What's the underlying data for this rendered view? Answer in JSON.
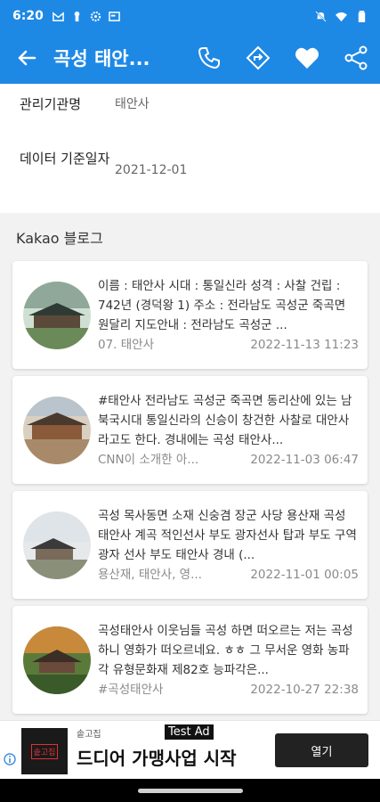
{
  "status_bar": {
    "time": "6:20",
    "left_icons": [
      "gmail-icon",
      "notification-icon",
      "settings-icon",
      "screenshot-icon"
    ],
    "right_icons": [
      "mute-icon",
      "wifi-icon",
      "battery-icon"
    ]
  },
  "app_bar": {
    "title": "곡성 태안...",
    "actions": [
      "phone-icon",
      "directions-icon",
      "favorite-icon",
      "share-icon"
    ]
  },
  "info": {
    "management_label": "관리기관명",
    "management_value": "태안사",
    "data_date_label": "데이터 기준일자",
    "data_date_value": "2021-12-01"
  },
  "blog_section": {
    "title": "Kakao 블로그",
    "posts": [
      {
        "snippet": "이름 : 태안사 시대 : 통일신라 성격 : 사찰 건립 : 742년 (경덕왕 1) 주소 : 전라남도 곡성군 죽곡면 원달리 지도안내 : 전라남도 곡성군 ...",
        "blog": "07. 태안사",
        "datetime": "2022-11-13 11:23"
      },
      {
        "snippet": "#태안사 전라남도 곡성군 죽곡면 동리산에 있는 남북국시대 통일신라의 신승이 창건한 사찰로 대안사라고도 한다. 경내에는 곡성 태안사...",
        "blog": "CNN이 소개한 아...",
        "datetime": "2022-11-03 06:47"
      },
      {
        "snippet": "곡성 목사동면 소재 신숭겸 장군 사당 용산재 곡성 태안사 계곡 적인선사 부도 광자선사 탑과 부도 구역 광자 선사 부도 태안사 경내 (...",
        "blog": "용산재, 태안사, 영...",
        "datetime": "2022-11-01 00:05"
      },
      {
        "snippet": "곡성태안사 이웃님들 곡성 하면 떠오르는 저는 곡성 하니 영화가 떠오르네요. ㅎㅎ 그 무서운 영화 농파각 유형문화재 제82호 능파각은...",
        "blog": "#곡성태안사",
        "datetime": "2022-10-27 22:38"
      }
    ]
  },
  "ad": {
    "test_label": "Test Ad",
    "advertiser": "솥고집",
    "logo_text": "솥고집",
    "headline": "드디어 가맹사업 시작",
    "open_button": "열기"
  },
  "colors": {
    "primary": "#1e88e5",
    "background": "#f2f2f2"
  }
}
